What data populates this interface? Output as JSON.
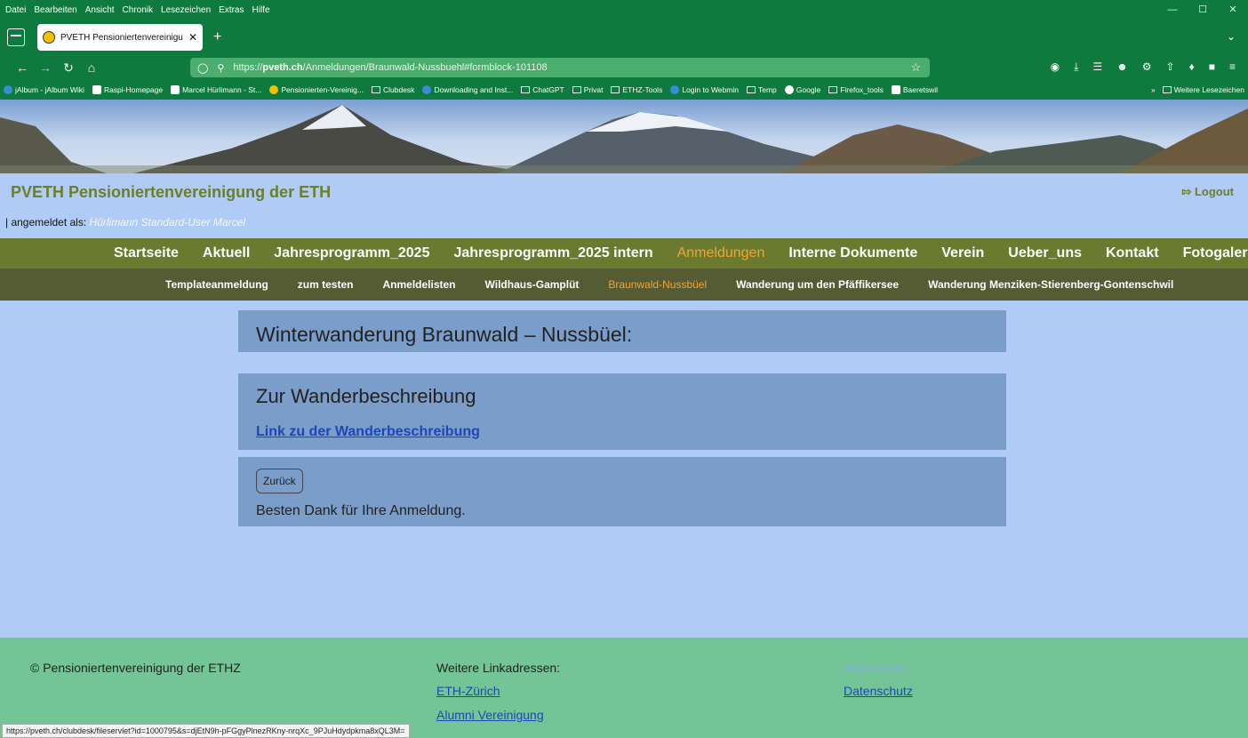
{
  "browser": {
    "menu": [
      "Datei",
      "Bearbeiten",
      "Ansicht",
      "Chronik",
      "Lesezeichen",
      "Extras",
      "Hilfe"
    ],
    "tab_title": "PVETH Pensioniertenvereinigun",
    "url_prefix": "https://",
    "url_domain": "pveth.ch",
    "url_path": "/Anmeldungen/Braunwald-Nussbuehl#formblock-101108",
    "bookmarks": [
      "jAlbum - jAlbum Wiki",
      "Raspi-Homepage",
      "Marcel Hürlimann - St...",
      "Pensionierten-Vereinig...",
      "Clubdesk",
      "Downloading and Inst...",
      "ChatGPT",
      "Privat",
      "ETHZ-Tools",
      "Login to Webmin",
      "Temp",
      "Google",
      "Firefox_tools",
      "Baeretswil"
    ],
    "bookmarks_more": "Weitere Lesezeichen",
    "status_url": "https://pveth.ch/clubdesk/fileservlet?id=1000795&s=djEtN9h-pFGgyPlnezRKny-nrqXc_9PJuHdydpkma8xQL3M="
  },
  "site": {
    "title": "PVETH Pensioniertenvereinigung der ETH",
    "logout": "Logout",
    "logged_label": "angemeldet als:",
    "logged_user": "Hürlimann Standard-User Marcel"
  },
  "main_nav": [
    "Startseite",
    "Aktuell",
    "Jahresprogramm_2025",
    "Jahresprogramm_2025 intern",
    "Anmeldungen",
    "Interne Dokumente",
    "Verein",
    "Ueber_uns",
    "Kontakt",
    "Fotogalerie"
  ],
  "main_nav_active": "Anmeldungen",
  "sub_nav": [
    "Templateanmeldung",
    "zum testen",
    "Anmeldelisten",
    "Wildhaus-Gamplüt",
    "Braunwald-Nussbüel",
    "Wanderung um den Pfäffikersee",
    "Wanderung Menziken-Stierenberg-Gontenschwil"
  ],
  "sub_nav_active": "Braunwald-Nussbüel",
  "content": {
    "heading": "Winterwanderung Braunwald – Nussbüel:",
    "section_title": "Zur Wanderbeschreibung",
    "link_label": "Link zu der Wanderbeschreibung",
    "back_button": "Zurück",
    "thanks": "Besten Dank für Ihre Anmeldung."
  },
  "footer": {
    "copyright": "© Pensioniertenvereinigung der ETHZ",
    "links_heading": "Weitere Linkadressen:",
    "eth": "ETH-Zürich",
    "alumni": "Alumni Vereinigung",
    "impressum": "Impressum",
    "datenschutz": "Datenschutz"
  }
}
